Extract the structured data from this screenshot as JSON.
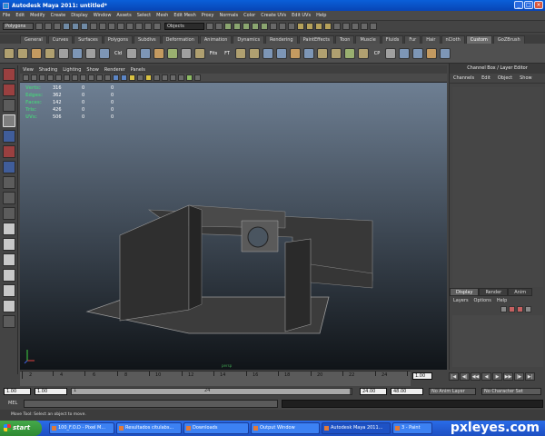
{
  "window": {
    "title": "Autodesk Maya 2011: untitled*",
    "minimize_glyph": "_",
    "maximize_glyph": "□",
    "close_glyph": "×"
  },
  "menubar": {
    "items": [
      "File",
      "Edit",
      "Modify",
      "Create",
      "Display",
      "Window",
      "Assets",
      "Select",
      "Mesh",
      "Edit Mesh",
      "Proxy",
      "Normals",
      "Color",
      "Create UVs",
      "Edit UVs",
      "Help"
    ]
  },
  "statusline": {
    "mode": "Polygons",
    "objects_field": "Objects"
  },
  "shelf": {
    "tabs": [
      "General",
      "Curves",
      "Surfaces",
      "Polygons",
      "Subdivs",
      "Deformation",
      "Animation",
      "Dynamics",
      "Rendering",
      "PaintEffects",
      "Toon",
      "Muscle",
      "Fluids",
      "Fur",
      "Hair",
      "nCloth",
      "Custom",
      "GoZBrush"
    ],
    "active_tab": "Custom",
    "labels": [
      "Cld",
      "Fits",
      "FT",
      "CP"
    ]
  },
  "panel": {
    "menu": [
      "View",
      "Shading",
      "Lighting",
      "Show",
      "Renderer",
      "Panels"
    ],
    "camera": "persp"
  },
  "hud": {
    "rows": [
      {
        "label": "Verts:",
        "v1": "316",
        "v2": "0",
        "v3": "0"
      },
      {
        "label": "Edges:",
        "v1": "362",
        "v2": "0",
        "v3": "0"
      },
      {
        "label": "Faces:",
        "v1": "142",
        "v2": "0",
        "v3": "0"
      },
      {
        "label": "Tris:",
        "v1": "426",
        "v2": "0",
        "v3": "0"
      },
      {
        "label": "UVs:",
        "v1": "506",
        "v2": "0",
        "v3": "0"
      }
    ]
  },
  "channelbox": {
    "title": "Channel Box / Layer Editor",
    "menu": [
      "Channels",
      "Edit",
      "Object",
      "Show"
    ]
  },
  "layers": {
    "tabs": [
      "Display",
      "Render",
      "Anim"
    ],
    "active_tab": "Display",
    "menu": [
      "Layers",
      "Options",
      "Help"
    ]
  },
  "timeline": {
    "ticks": [
      "2",
      "4",
      "6",
      "8",
      "10",
      "12",
      "14",
      "16",
      "18",
      "20",
      "22",
      "24"
    ],
    "current_frame": "1.00",
    "playback_buttons": [
      "|◀",
      "◀|",
      "◀◀",
      "◀",
      "▶",
      "▶▶",
      "|▶",
      "▶|"
    ]
  },
  "range": {
    "start_time": "1.00",
    "start_range": "1.00",
    "range_start_label": "1",
    "range_end_label": "24",
    "end_range": "24.00",
    "end_time": "48.00",
    "anim_layer": "No Anim Layer",
    "character_set": "No Character Set"
  },
  "commandline": {
    "label": "MEL"
  },
  "helpline": {
    "text": "Move Tool: Select an object to move."
  },
  "taskbar": {
    "start": "start",
    "items": [
      "100_F.O.D - Pixel M...",
      "Resultados citulabs...",
      "Downloads",
      "Output Window",
      "Autodesk Maya 2011...",
      "3 - Paint"
    ],
    "active_index": 4,
    "watermark": "pxleyes.com"
  },
  "colors": {
    "viewport_top": "#6e7f93",
    "viewport_bottom": "#101418",
    "hud_label": "#4ec17e",
    "model": "#3a3a3a"
  }
}
